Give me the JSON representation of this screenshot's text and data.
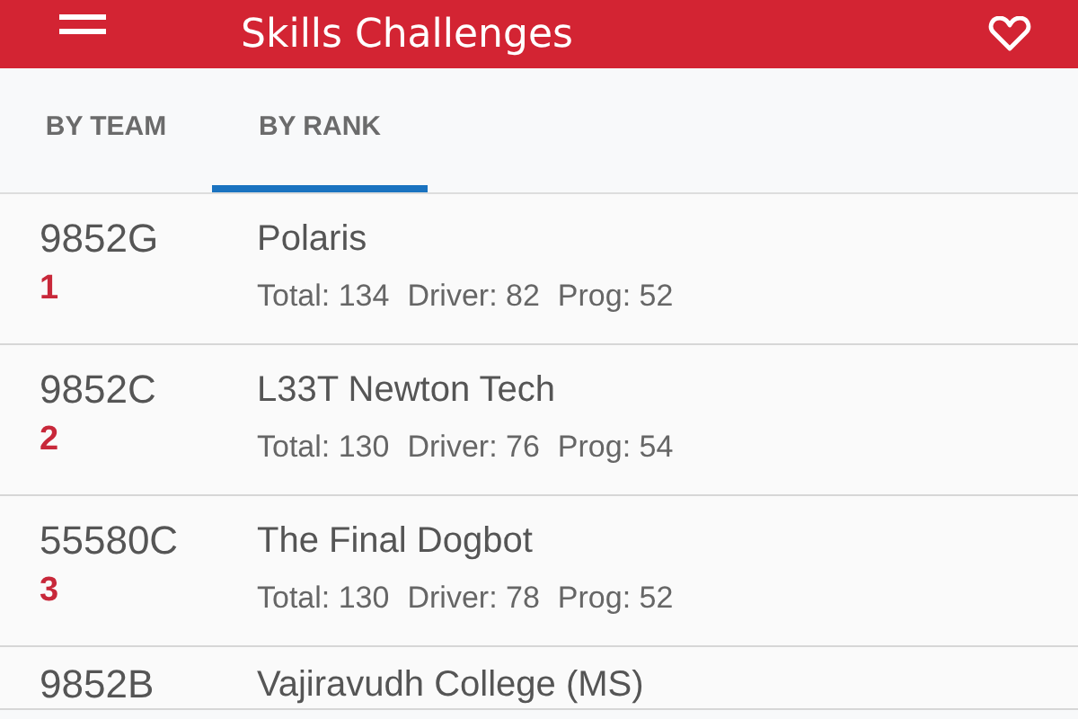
{
  "app_bar": {
    "title": "Skills Challenges"
  },
  "tabs": [
    {
      "label": "BY TEAM",
      "selected": false
    },
    {
      "label": "BY RANK",
      "selected": true
    }
  ],
  "rows": [
    {
      "team": "9852G",
      "rank": "1",
      "name": "Polaris",
      "total": "Total: 134",
      "driver": "Driver: 82",
      "prog": "Prog: 52"
    },
    {
      "team": "9852C",
      "rank": "2",
      "name": "L33T Newton Tech",
      "total": "Total: 130",
      "driver": "Driver: 76",
      "prog": "Prog: 54"
    },
    {
      "team": "55580C",
      "rank": "3",
      "name": "The Final Dogbot",
      "total": "Total: 130",
      "driver": "Driver: 78",
      "prog": "Prog: 52"
    },
    {
      "team": "9852B",
      "name": "Vajiravudh College (MS)"
    }
  ]
}
